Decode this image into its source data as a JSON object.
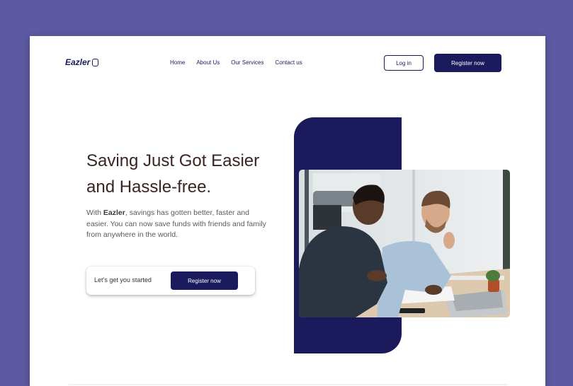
{
  "brand": {
    "name": "Eazler"
  },
  "nav": {
    "items": [
      "Home",
      "About Us",
      "Our Services",
      "Contact us"
    ]
  },
  "header": {
    "login_label": "Log in",
    "register_label": "Register now"
  },
  "hero": {
    "title_line1": "Saving Just Got Easier",
    "title_line2": "and Hassle-free.",
    "body_prefix": "With ",
    "body_brand": "Eazler",
    "body_suffix": ", savings has gotten better, faster and easier. You can now save  funds with friends  and family from anywhere in the world.",
    "cta_text": "Let’s get you started",
    "cta_button": "Register now"
  },
  "colors": {
    "background": "#5d5aa3",
    "primary": "#1b1a5c",
    "heading": "#3a2424"
  }
}
